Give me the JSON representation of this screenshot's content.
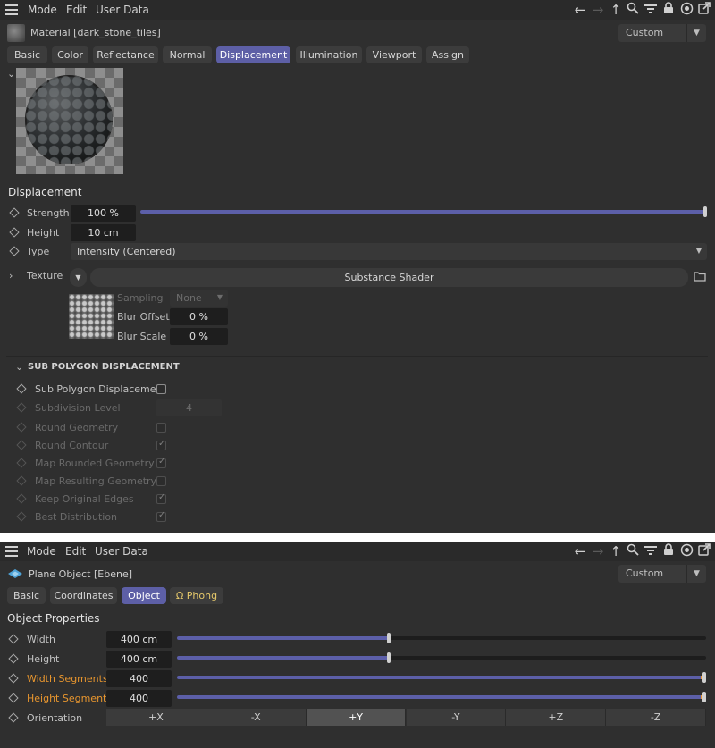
{
  "menu": {
    "mode": "Mode",
    "edit": "Edit",
    "user_data": "User Data"
  },
  "panel1": {
    "title": "Material [dark_stone_tiles]",
    "layout_dropdown": "Custom",
    "tabs": [
      "Basic",
      "Color",
      "Reflectance",
      "Normal",
      "Displacement",
      "Illumination",
      "Viewport",
      "Assign"
    ],
    "active_tab": "Displacement",
    "section": "Displacement",
    "strength": {
      "label": "Strength",
      "value": "100 %",
      "fraction": 1.0
    },
    "height": {
      "label": "Height",
      "value": "10 cm"
    },
    "type": {
      "label": "Type",
      "value": "Intensity (Centered)"
    },
    "texture": {
      "label": "Texture",
      "shader": "Substance Shader"
    },
    "sampling": {
      "label": "Sampling",
      "value": "None"
    },
    "blur_offset": {
      "label": "Blur Offset",
      "value": "0 %"
    },
    "blur_scale": {
      "label": "Blur Scale",
      "value": "0 %"
    },
    "subpoly": {
      "header": "SUB POLYGON DISPLACEMENT",
      "toggle_label": "Sub Polygon Displacement",
      "subdivision_label": "Subdivision Level",
      "subdivision_value": "4",
      "options": [
        {
          "label": "Round Geometry",
          "checked": false
        },
        {
          "label": "Round Contour",
          "checked": true
        },
        {
          "label": "Map Rounded Geometry",
          "checked": true
        },
        {
          "label": "Map Resulting Geometry",
          "checked": false
        },
        {
          "label": "Keep Original Edges",
          "checked": true
        },
        {
          "label": "Best Distribution",
          "checked": true
        }
      ]
    }
  },
  "panel2": {
    "title": "Plane Object [Ebene]",
    "layout_dropdown": "Custom",
    "tabs": [
      "Basic",
      "Coordinates",
      "Object",
      "Phong"
    ],
    "active_tab": "Object",
    "section": "Object Properties",
    "width": {
      "label": "Width",
      "value": "400 cm",
      "fraction": 0.4
    },
    "height": {
      "label": "Height",
      "value": "400 cm",
      "fraction": 0.4
    },
    "width_segments": {
      "label": "Width Segments",
      "value": "400",
      "fraction": 1.0
    },
    "height_segments": {
      "label": "Height Segments",
      "value": "400",
      "fraction": 1.0
    },
    "orientation": {
      "label": "Orientation",
      "options": [
        "+X",
        "-X",
        "+Y",
        "-Y",
        "+Z",
        "-Z"
      ],
      "selected": "+Y"
    }
  },
  "colors": {
    "accent": "#5d5fa6",
    "orange": "#e8962e",
    "panel_bg": "#2f2f2f"
  }
}
